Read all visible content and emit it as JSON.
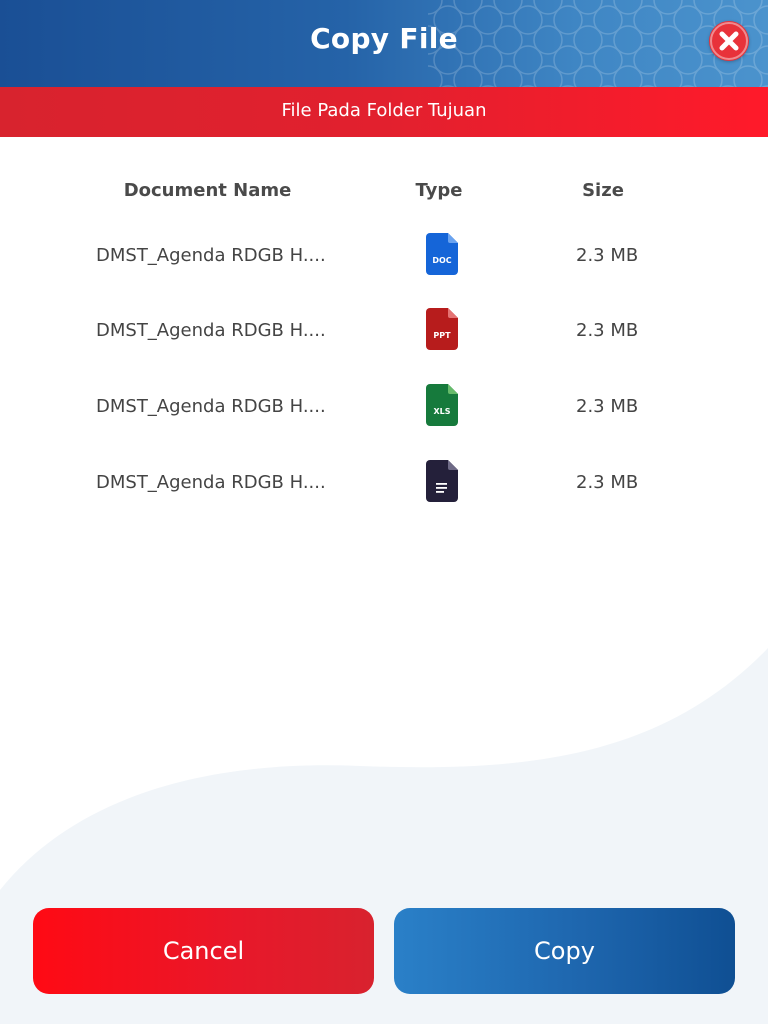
{
  "dialog": {
    "title": "Copy File",
    "close_icon": "close-x-circle-icon",
    "accent_blue": "#1a4f95",
    "accent_red": "#e2202e"
  },
  "banner": {
    "text": "File Pada Folder Tujuan"
  },
  "table": {
    "columns": {
      "name": "Document Name",
      "type": "Type",
      "size": "Size"
    },
    "rows": [
      {
        "name": "DMST_Agenda RDGB H....",
        "type_icon": "doc-file-icon",
        "type_label": "DOC",
        "type_color": "#1565d8",
        "size": "2.3 MB"
      },
      {
        "name": "DMST_Agenda RDGB H....",
        "type_icon": "ppt-file-icon",
        "type_label": "PPT",
        "type_color": "#b71c1c",
        "size": "2.3 MB"
      },
      {
        "name": "DMST_Agenda RDGB H....",
        "type_icon": "xls-file-icon",
        "type_label": "XLS",
        "type_color": "#167a3c",
        "size": "2.3 MB"
      },
      {
        "name": "DMST_Agenda RDGB H....",
        "type_icon": "text-file-icon",
        "type_label": "",
        "type_color": "#24203a",
        "size": "2.3 MB"
      }
    ]
  },
  "actions": {
    "cancel_label": "Cancel",
    "copy_label": "Copy"
  }
}
